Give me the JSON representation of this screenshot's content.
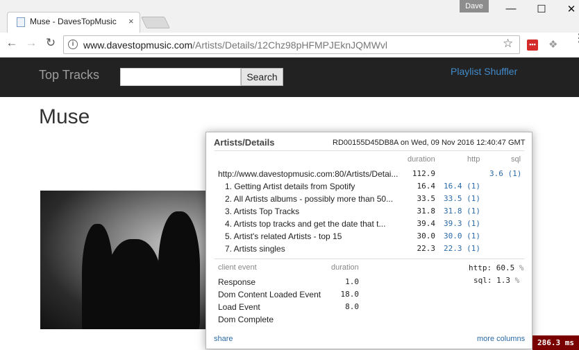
{
  "browser": {
    "tab_title": "Muse - DavesTopMusic",
    "tab_close": "×",
    "user": "Dave",
    "url_host": "www.davestopmusic.com",
    "url_path": "/Artists/Details/12Chz98pHFMPJEknJQMWvl",
    "info_glyph": "i",
    "icons": {
      "back": "←",
      "forward": "→",
      "reload": "↻",
      "star": "☆",
      "minimize": "—",
      "maximize": "☐",
      "close": "✕",
      "ext_dropbox": "❖",
      "menu": "⋮",
      "ext_red": "•••"
    }
  },
  "site": {
    "brand": "Top Tracks",
    "search_value": "",
    "search_button": "Search",
    "nav_link": "Playlist Shuffler",
    "heading": "Muse"
  },
  "profiler": {
    "title": "Artists/Details",
    "meta": "RD00155D45DB8A on Wed, 09 Nov 2016 12:40:47 GMT",
    "col_duration": "duration",
    "col_http": "http",
    "col_sql": "sql",
    "root": {
      "label": "http://www.davestopmusic.com:80/Artists/Detai...",
      "duration": "112.9",
      "sql": "3.6",
      "sql_count": "(1)"
    },
    "steps": [
      {
        "label": "1. Getting Artist details from Spotify",
        "duration": "16.4",
        "http": "16.4",
        "count": "(1)"
      },
      {
        "label": "2. All Artists albums - possibly more than 50...",
        "duration": "33.5",
        "http": "33.5",
        "count": "(1)"
      },
      {
        "label": "3. Artists Top Tracks",
        "duration": "31.8",
        "http": "31.8",
        "count": "(1)"
      },
      {
        "label": "4. Artists top tracks and get the date that t...",
        "duration": "39.4",
        "http": "39.3",
        "count": "(1)"
      },
      {
        "label": "5. Artist's related Artists - top 15",
        "duration": "30.0",
        "http": "30.0",
        "count": "(1)"
      },
      {
        "label": "7. Artists singles",
        "duration": "22.3",
        "http": "22.3",
        "count": "(1)"
      }
    ],
    "client_header": "client event",
    "client_duration_header": "duration",
    "client_events": [
      {
        "label": "Response",
        "duration": "1.0"
      },
      {
        "label": "Dom Content Loaded Event",
        "duration": "18.0"
      },
      {
        "label": "Load Event",
        "duration": "8.0"
      },
      {
        "label": "Dom Complete",
        "duration": ""
      }
    ],
    "summary": [
      {
        "label": "http:",
        "value": "60.5",
        "unit": "%"
      },
      {
        "label": "sql:",
        "value": "1.3",
        "unit": "%"
      }
    ],
    "share": "share",
    "more_columns": "more columns"
  },
  "timer": "286.3 ms"
}
